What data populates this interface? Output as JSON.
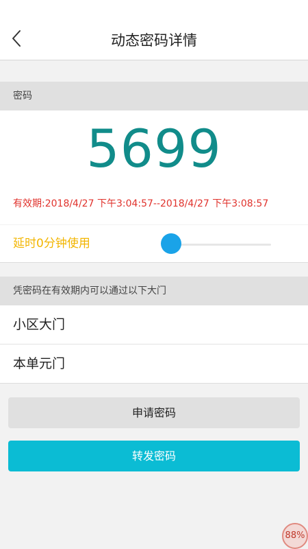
{
  "header": {
    "title": "动态密码详情",
    "back_icon": "chevron-left-icon"
  },
  "code_section": {
    "label": "密码",
    "code": "5699",
    "validity": "有效期:2018/4/27 下午3:04:57--2018/4/27 下午3:08:57"
  },
  "delay": {
    "label": "延时0分钟使用",
    "slider_value_fraction": 0
  },
  "gates_section": {
    "label": "凭密码在有效期内可以通过以下大门",
    "items": [
      {
        "label": "小区大门"
      },
      {
        "label": "本单元门"
      }
    ]
  },
  "buttons": {
    "apply_label": "申请密码",
    "forward_label": "转发密码"
  },
  "overlay": {
    "zoom": "88%"
  },
  "colors": {
    "code": "#118c8a",
    "validity": "#e0322c",
    "delay_label": "#f2b500",
    "slider_thumb": "#1aa3e8",
    "forward_button": "#0bbcd4"
  }
}
